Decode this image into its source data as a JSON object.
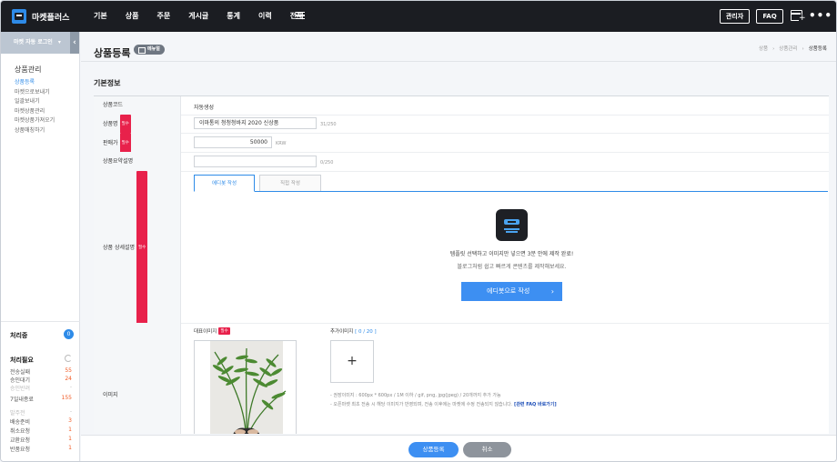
{
  "app": {
    "name": "마켓플러스"
  },
  "nav": {
    "items": [
      "기본",
      "상품",
      "주문",
      "게시글",
      "통계",
      "이력",
      "전체"
    ]
  },
  "topbar": {
    "admin_label": "관리자",
    "faq_label": "FAQ",
    "more_label": "•••"
  },
  "sidebar": {
    "market_login": "마켓 자동 로그인",
    "section_title": "상품관리",
    "items": [
      {
        "label": "상품등록",
        "active": true
      },
      {
        "label": "마켓으로보내기",
        "active": false
      },
      {
        "label": "일괄보내기",
        "active": false
      },
      {
        "label": "마켓상품관리",
        "active": false
      },
      {
        "label": "마켓상품가져오기",
        "active": false
      },
      {
        "label": "상품매칭하기",
        "active": false
      }
    ],
    "processing_title": "처리중",
    "processing_count": "0",
    "needs_title": "처리필요",
    "stats": [
      {
        "label": "전송실패",
        "value": "55",
        "dim": false
      },
      {
        "label": "승인대기",
        "value": "24",
        "dim": false
      },
      {
        "label": "승인반려",
        "value": "-",
        "dim": true
      },
      {
        "label": "7일내종료",
        "value": "155",
        "dim": false
      },
      {
        "label": "발주전",
        "value": "-",
        "dim": true
      },
      {
        "label": "배송준비",
        "value": "3",
        "dim": false
      },
      {
        "label": "취소요청",
        "value": "1",
        "dim": false
      },
      {
        "label": "교환요청",
        "value": "1",
        "dim": false
      },
      {
        "label": "반품요청",
        "value": "1",
        "dim": false
      }
    ]
  },
  "page": {
    "title": "상품등록",
    "manual_label": "메뉴얼",
    "breadcrumb": [
      "상품",
      "상품관리",
      "상품등록"
    ],
    "section_title": "기본정보"
  },
  "form": {
    "product_code": {
      "label": "상품코드",
      "value": "자동생성"
    },
    "product_name": {
      "label": "상품명",
      "value": "이마통의 청청청바지 2020 신상품",
      "count": "31/250"
    },
    "price": {
      "label": "판매가",
      "value": "50000",
      "unit": "KRW"
    },
    "summary": {
      "label": "상품요약설명",
      "value": "",
      "count": "0/250"
    },
    "detail": {
      "label": "상품 상세설명",
      "tab_editor": "에디봇 작성",
      "tab_direct": "직접 작성",
      "line1": "템플릿 선택하고 이미지만 넣으면 3분 안에 제작 완료!",
      "line2": "블로그처럼 쉽고 빠르게 콘텐츠를 제작해보세요.",
      "button": "에디봇으로 작성"
    },
    "image": {
      "label": "이미지",
      "main_label": "대표이미지",
      "extra_label": "추가이미지",
      "extra_count": "[ 0 / 20 ]",
      "note1": "- 권장이미지 : 600px * 600px / 1M 이하 / gif, png, jpg(jpeg) / 20개까지 추가 가능",
      "note2": "- 오픈마켓 최초 전송 시 해당 이미지가 반영되며, 전송 이후에는 마켓에 수정 전송되지 않습니다.",
      "note_link": "[관련 FAQ 바로가기]"
    },
    "required_badge": "필수"
  },
  "actions": {
    "save": "상품등록",
    "cancel": "취소"
  },
  "colors": {
    "accent": "#3d8ff2",
    "required": "#e8214b",
    "topbar": "#1b1d22"
  }
}
